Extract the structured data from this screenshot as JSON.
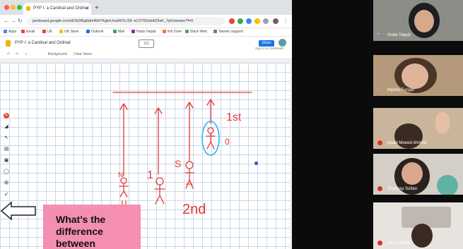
{
  "browser": {
    "tab_title": "PYP I: a Cardinal and Ordinal",
    "url": "jamboard.google.com/d/1E9Rg6dmWbYKgbrUnaWOL/SK eC2Y5ScbAZ9aF_7ptUviewer?f=0",
    "bookmarks": [
      "Apps",
      "Email",
      "UK",
      "UK Store",
      "Outlook",
      "Mail",
      "Huda Yaqub",
      "Kid Zone",
      "Slack Web",
      "Tawsec support"
    ]
  },
  "jamboard": {
    "title": "PYP I: a Cardinal and Ordinal",
    "frame_label": "1/1",
    "share_label": "Share",
    "signin_label": "Sign in to Jamboard",
    "tools": [
      "Background",
      "Clear frame"
    ],
    "card_text": "What's the\ndifference\nbetween",
    "pen_color": "#ea4335",
    "drawing_color": "#e53935",
    "highlight_color": "#29b6f6",
    "handwriting": {
      "first": "1st",
      "second": "2nd",
      "zero": "0",
      "one": "1",
      "s": "S",
      "n": "N"
    }
  },
  "meet": {
    "participants": [
      {
        "name": "Huda Yaqub",
        "muted": false
      },
      {
        "name": "Mysha Furqan",
        "muted": false
      },
      {
        "name": "Iyaad Moeed Ahmed",
        "muted": true
      },
      {
        "name": "Shahzay Sultan",
        "muted": true
      },
      {
        "name": "Omer Habib",
        "muted": true
      }
    ]
  }
}
